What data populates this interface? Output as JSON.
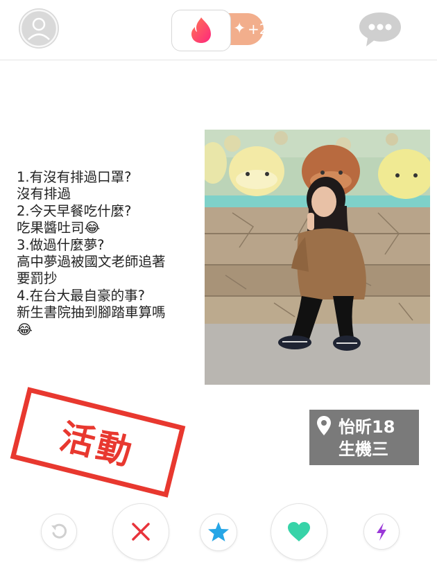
{
  "topbar": {
    "boost_star": "✦",
    "boost_count": "+2",
    "icons": [
      "profile-avatar-icon",
      "flame-logo-icon",
      "chat-bubble-icon"
    ]
  },
  "bio": {
    "lines": [
      "1.有沒有排過口罩?",
      "沒有排過",
      "2.今天早餐吃什麼?",
      "吃果醬吐司😂",
      "3.做過什麼夢?",
      "高中夢過被國文老師追著",
      "要罰抄",
      "4.在台大最自豪的事?",
      "新生書院抽到腳踏車算嗎",
      "😂"
    ]
  },
  "stamp": {
    "text": "活動"
  },
  "info": {
    "name_age": "怡昕18",
    "department": "生機三"
  },
  "actions": {
    "icons": [
      "rewind-icon",
      "nope-x-icon",
      "super-like-star-icon",
      "like-heart-icon",
      "boost-bolt-icon"
    ]
  },
  "colors": {
    "brand": "#fe3c72",
    "boost": "#f2ae8c",
    "stamp": "#e8382f",
    "like": "#37d3a8",
    "superlike": "#27a6e6",
    "nope": "#e8333b",
    "boost_bolt": "#9a38d8",
    "info_bg": "#7a7a7a"
  }
}
